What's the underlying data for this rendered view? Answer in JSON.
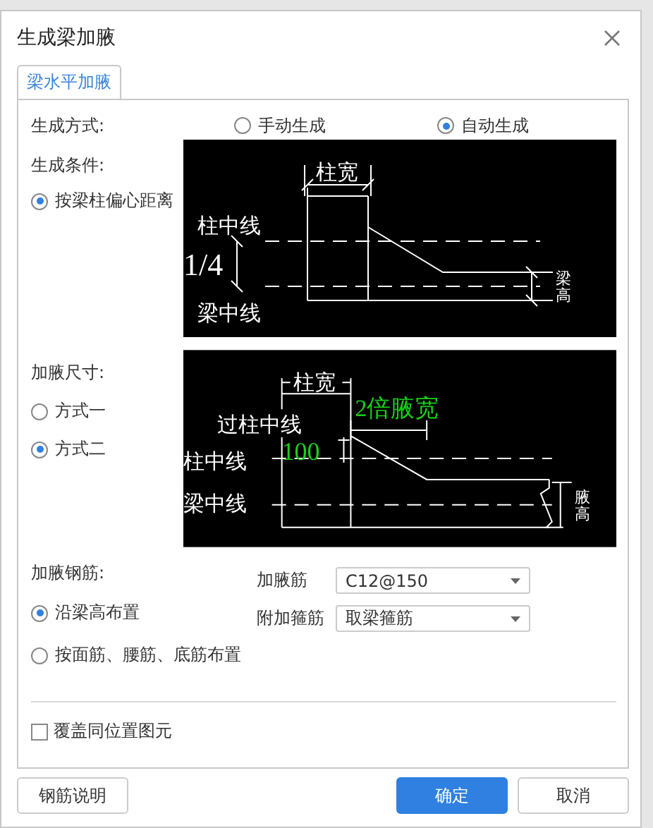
{
  "dialog": {
    "title": "生成梁加腋"
  },
  "tabs": [
    {
      "label": "梁水平加腋",
      "selected": true
    }
  ],
  "generation_method": {
    "label": "生成方式:",
    "options": [
      {
        "label": "手动生成",
        "selected": false
      },
      {
        "label": "自动生成",
        "selected": true
      }
    ]
  },
  "generation_condition": {
    "label": "生成条件:",
    "options": [
      {
        "label": "按梁柱偏心距离",
        "selected": true
      }
    ]
  },
  "diagram_1": {
    "labels": [
      "柱宽",
      "柱中线",
      "1/4",
      "梁中线",
      "梁高"
    ]
  },
  "haunch_size": {
    "label": "加腋尺寸:",
    "options": [
      {
        "label": "方式一",
        "selected": false
      },
      {
        "label": "方式二",
        "selected": true
      }
    ]
  },
  "diagram_2": {
    "labels": [
      "柱宽",
      "2倍腋宽",
      "过柱中线",
      "100",
      "柱中线",
      "梁中线",
      "腋高"
    ]
  },
  "haunch_rebar": {
    "label": "加腋钢筋:",
    "options": [
      {
        "label": "沿梁高布置",
        "selected": true
      },
      {
        "label": "按面筋、腰筋、底筋布置",
        "selected": false
      }
    ],
    "fields": [
      {
        "label": "加腋筋",
        "value": "C12@150"
      },
      {
        "label": "附加箍筋",
        "value": "取梁箍筋"
      }
    ]
  },
  "overwrite": {
    "label": "覆盖同位置图元",
    "checked": false
  },
  "buttons": [
    {
      "label": "钢筋说明",
      "kind": "default"
    },
    {
      "label": "确定",
      "kind": "primary"
    },
    {
      "label": "取消",
      "kind": "default"
    }
  ]
}
